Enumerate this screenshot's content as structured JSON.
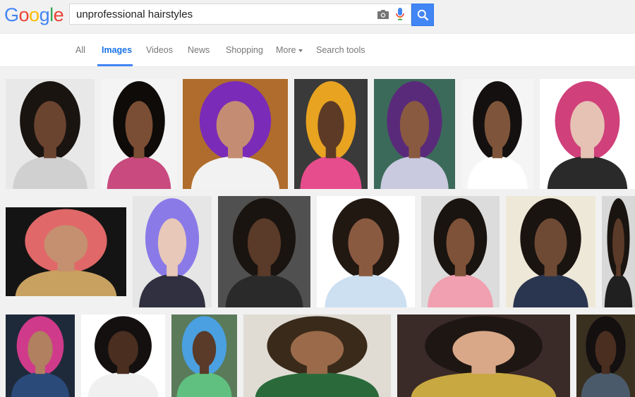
{
  "logo": {
    "letters": [
      "G",
      "o",
      "o",
      "g",
      "l",
      "e"
    ],
    "colors": [
      "#4285f4",
      "#ea4335",
      "#fbbc05",
      "#4285f4",
      "#34a853",
      "#ea4335"
    ]
  },
  "search": {
    "query": "unprofessional hairstyles",
    "camera_icon": "camera-icon",
    "mic_icon": "mic-icon",
    "submit_icon": "search-icon"
  },
  "tabs": [
    {
      "label": "All"
    },
    {
      "label": "Images"
    },
    {
      "label": "Videos"
    },
    {
      "label": "News"
    },
    {
      "label": "Shopping"
    },
    {
      "label": "More"
    },
    {
      "label": "Search tools"
    }
  ],
  "active_tab": "Images",
  "accent_color": "#4285f4",
  "results": [
    {
      "row": 1,
      "bg": "#e8e8e8",
      "hair": "#1a1410",
      "skin": "#6b4430",
      "top": "#d0d0d0"
    },
    {
      "row": 1,
      "bg": "#f4f4f4",
      "hair": "#0e0b09",
      "skin": "#7a4e34",
      "top": "#c84a7e"
    },
    {
      "row": 1,
      "bg": "#b06c2c",
      "hair": "#7a2bb8",
      "skin": "#c48c72",
      "top": "#f2f2f2"
    },
    {
      "row": 1,
      "bg": "#3a3a3a",
      "hair": "#e8a320",
      "skin": "#5c3a26",
      "top": "#e64d8c"
    },
    {
      "row": 1,
      "bg": "#3c6a5a",
      "hair": "#5a2a7a",
      "skin": "#8a5a40",
      "top": "#c9c9e0"
    },
    {
      "row": 1,
      "bg": "#f5f5f5",
      "hair": "#151010",
      "skin": "#7e553a",
      "top": "#ffffff"
    },
    {
      "row": 1,
      "bg": "#ffffff",
      "hair": "#d0407a",
      "skin": "#e6c2b4",
      "top": "#2a2a2a"
    },
    {
      "row": 2,
      "bg": "#141414",
      "hair": "#e06868",
      "skin": "#c49070",
      "top": "#c8a060"
    },
    {
      "row": 2,
      "bg": "#e6e6e6",
      "hair": "#8a7ae8",
      "skin": "#e8c8b8",
      "top": "#303040"
    },
    {
      "row": 2,
      "bg": "#505050",
      "hair": "#1a1410",
      "skin": "#5a3a28",
      "top": "#2a2a2a"
    },
    {
      "row": 2,
      "bg": "#ffffff",
      "hair": "#221812",
      "skin": "#8a5a40",
      "top": "#cde0f2"
    },
    {
      "row": 2,
      "bg": "#dcdcdc",
      "hair": "#1a1410",
      "skin": "#7e5238",
      "top": "#f0a0b0"
    },
    {
      "row": 2,
      "bg": "#eee8d8",
      "hair": "#1a1410",
      "skin": "#6e4a34",
      "top": "#2a3550"
    },
    {
      "row": 2,
      "bg": "#d8d8d8",
      "hair": "#1a1410",
      "skin": "#5a3a28",
      "top": "#202020"
    },
    {
      "row": 3,
      "bg": "#1e2a3a",
      "hair": "#d03a8a",
      "skin": "#b08060",
      "top": "#2a4a7a"
    },
    {
      "row": 3,
      "bg": "#ffffff",
      "hair": "#141010",
      "skin": "#4a2e20",
      "top": "#f0f0f0"
    },
    {
      "row": 3,
      "bg": "#5a7a5a",
      "hair": "#4aa0e0",
      "skin": "#5a3a28",
      "top": "#60c080"
    },
    {
      "row": 3,
      "bg": "#e0dcd4",
      "hair": "#3a2a1a",
      "skin": "#9a6a4a",
      "top": "#2a6a3a"
    },
    {
      "row": 3,
      "bg": "#3a2a28",
      "hair": "#1e1612",
      "skin": "#d8a888",
      "top": "#c8a840"
    },
    {
      "row": 3,
      "bg": "#3a3020",
      "hair": "#141010",
      "skin": "#4a2e20",
      "top": "#4a5a6a"
    }
  ]
}
